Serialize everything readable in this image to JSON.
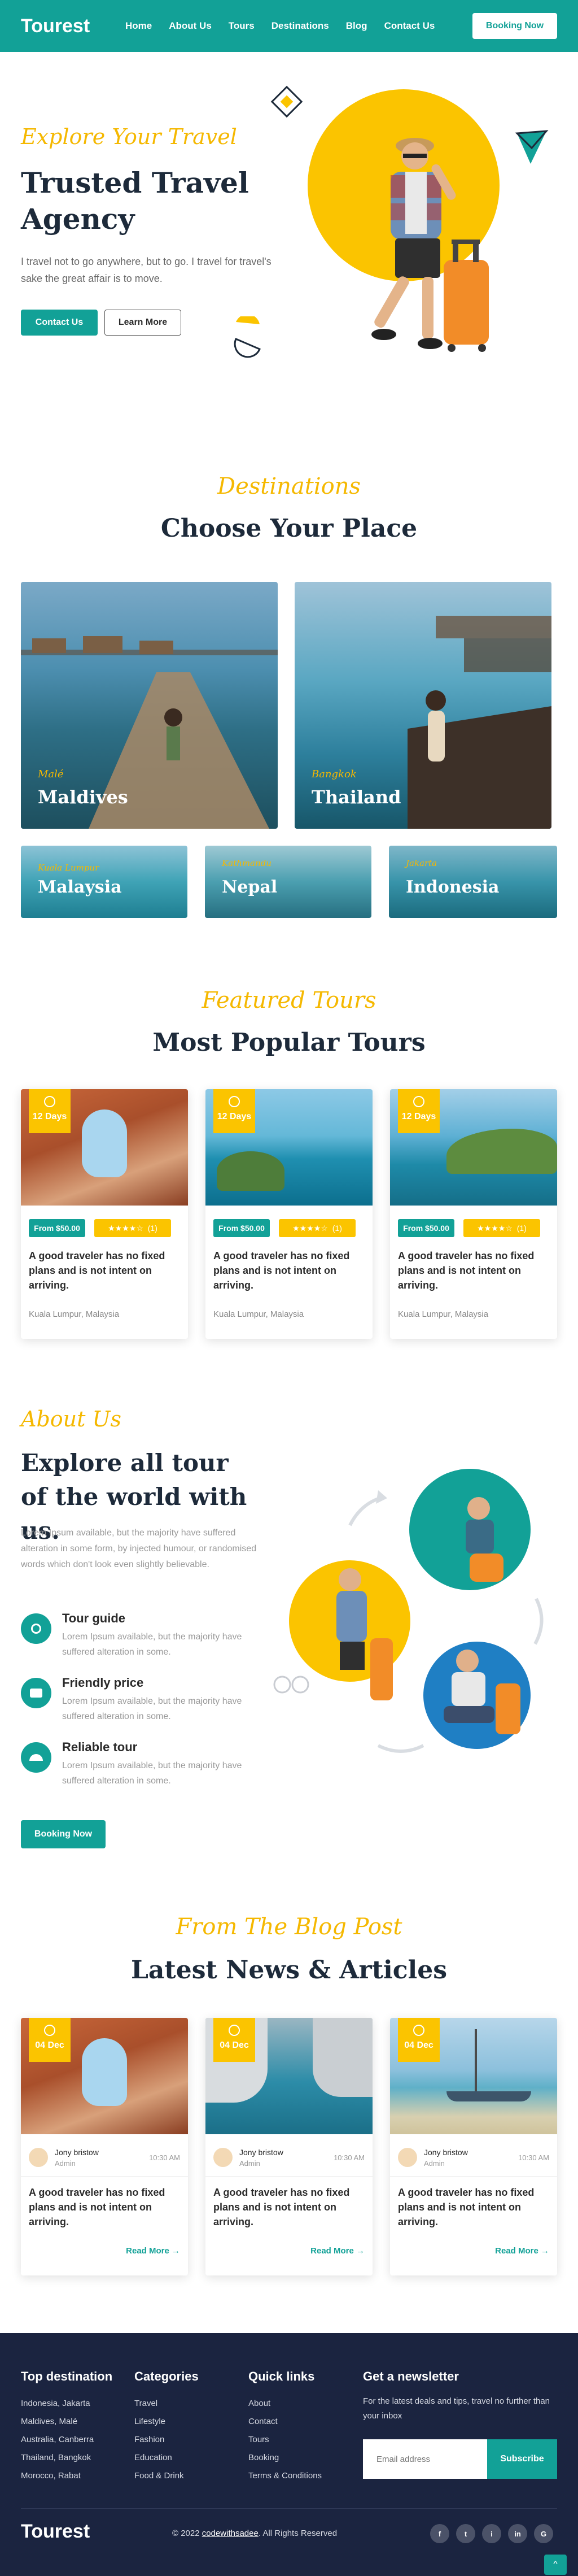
{
  "header": {
    "logo": "Tourest",
    "nav": [
      "Home",
      "About Us",
      "Tours",
      "Destinations",
      "Blog",
      "Contact Us"
    ],
    "cta": "Booking Now"
  },
  "hero": {
    "script": "Explore Your Travel",
    "title": "Trusted Travel Agency",
    "text": "I travel not to go anywhere, but to go. I travel for travel's sake the great affair is to move.",
    "btn_primary": "Contact Us",
    "btn_secondary": "Learn More"
  },
  "destinations": {
    "script": "Destinations",
    "title": "Choose Your Place",
    "items": [
      {
        "small": "Malé",
        "name": "Maldives"
      },
      {
        "small": "Bangkok",
        "name": "Thailand"
      },
      {
        "small": "Kuala Lumpur",
        "name": "Malaysia"
      },
      {
        "small": "Kathmandu",
        "name": "Nepal"
      },
      {
        "small": "Jakarta",
        "name": "Indonesia"
      }
    ]
  },
  "tours": {
    "script": "Featured Tours",
    "title": "Most Popular Tours",
    "items": [
      {
        "days": "12 Days",
        "price": "From $50.00",
        "reviews": "(1)",
        "title": "A good traveler has no fixed plans and is not intent on arriving.",
        "location": "Kuala Lumpur, Malaysia"
      },
      {
        "days": "12 Days",
        "price": "From $50.00",
        "reviews": "(1)",
        "title": "A good traveler has no fixed plans and is not intent on arriving.",
        "location": "Kuala Lumpur, Malaysia"
      },
      {
        "days": "12 Days",
        "price": "From $50.00",
        "reviews": "(1)",
        "title": "A good traveler has no fixed plans and is not intent on arriving.",
        "location": "Kuala Lumpur, Malaysia"
      }
    ]
  },
  "about": {
    "script": "About Us",
    "title": "Explore all tour of the world with us.",
    "text": "Lorem Ipsum available, but the majority have suffered alteration in some form, by injected humour, or randomised words which don't look even slightly believable.",
    "features": [
      {
        "title": "Tour guide",
        "text": "Lorem Ipsum available, but the majority have suffered alteration in some."
      },
      {
        "title": "Friendly price",
        "text": "Lorem Ipsum available, but the majority have suffered alteration in some."
      },
      {
        "title": "Reliable tour",
        "text": "Lorem Ipsum available, but the majority have suffered alteration in some."
      }
    ],
    "cta": "Booking Now"
  },
  "blog": {
    "script": "From The Blog Post",
    "title": "Latest News & Articles",
    "items": [
      {
        "date": "04 Dec",
        "author": "Jony bristow",
        "role": "Admin",
        "time": "10:30 AM",
        "title": "A good traveler has no fixed plans and is not intent on arriving.",
        "more": "Read More"
      },
      {
        "date": "04 Dec",
        "author": "Jony bristow",
        "role": "Admin",
        "time": "10:30 AM",
        "title": "A good traveler has no fixed plans and is not intent on arriving.",
        "more": "Read More"
      },
      {
        "date": "04 Dec",
        "author": "Jony bristow",
        "role": "Admin",
        "time": "10:30 AM",
        "title": "A good traveler has no fixed plans and is not intent on arriving.",
        "more": "Read More"
      }
    ]
  },
  "footer": {
    "col1": {
      "title": "Top destination",
      "items": [
        "Indonesia, Jakarta",
        "Maldives, Malé",
        "Australia, Canberra",
        "Thailand, Bangkok",
        "Morocco, Rabat"
      ]
    },
    "col2": {
      "title": "Categories",
      "items": [
        "Travel",
        "Lifestyle",
        "Fashion",
        "Education",
        "Food & Drink"
      ]
    },
    "col3": {
      "title": "Quick links",
      "items": [
        "About",
        "Contact",
        "Tours",
        "Booking",
        "Terms & Conditions"
      ]
    },
    "newsletter": {
      "title": "Get a newsletter",
      "text": "For the latest deals and tips, travel no further than your inbox",
      "placeholder": "Email address",
      "button": "Subscribe"
    },
    "logo": "Tourest",
    "copyright_prefix": "© 2022 ",
    "copyright_link": "codewithsadee",
    "copyright_suffix": ". All Rights Reserved",
    "social": [
      "f",
      "t",
      "i",
      "in",
      "G"
    ]
  },
  "colors": {
    "teal": "#12a197",
    "yellow": "#fbc400",
    "navy": "#1b2440",
    "title": "#1d2a3a"
  }
}
